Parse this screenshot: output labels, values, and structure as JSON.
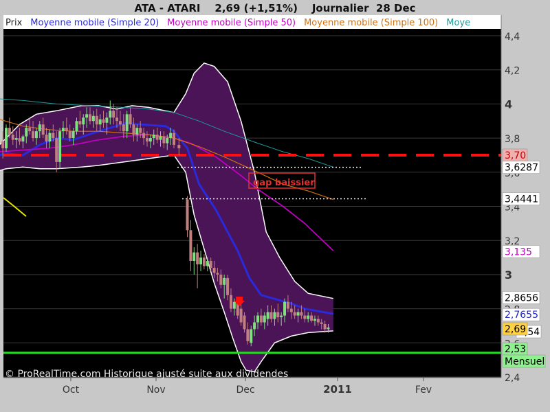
{
  "header": {
    "title": "ATA - ATARI",
    "price": "2,69 (+1,51%)",
    "period": "Journalier",
    "date": "28 Dec"
  },
  "legend": [
    {
      "label": "Prix",
      "color": "#222222"
    },
    {
      "label": "Moyenne mobile (Simple 20)",
      "color": "#2a2adc"
    },
    {
      "label": "Moyenne mobile (Simple 50)",
      "color": "#c000c0"
    },
    {
      "label": "Moyenne mobile (Simple 100)",
      "color": "#d07010"
    },
    {
      "label": "Moye",
      "color": "#209a9a"
    }
  ],
  "watermark": "© ProRealTime.com Historique ajusté suite aux dividendes",
  "chart_data": {
    "type": "candlestick",
    "ylim": [
      2.4,
      4.5
    ],
    "y_ticks": [
      "2,4",
      "2,6",
      "2,8",
      "3",
      "3,2",
      "3,4",
      "3,6",
      "3,8",
      "4",
      "4,2",
      "4,4"
    ],
    "x_labels": [
      {
        "label": "Oct",
        "date": "2010-10-01"
      },
      {
        "label": "Nov",
        "date": "2010-11-01"
      },
      {
        "label": "Dec",
        "date": "2010-12-01"
      },
      {
        "label": "2011",
        "date": "2011-01-01"
      },
      {
        "label": "Fev",
        "date": "2011-02-01"
      }
    ],
    "annotation": "gap baissier",
    "resistance_line": 3.7,
    "support_line": 2.53,
    "gap_lines": [
      3.6287,
      3.4441
    ],
    "price_tags": [
      {
        "text": "3,70",
        "value": 3.7,
        "bg": "#f0b0b0",
        "fg": "#c00000"
      },
      {
        "text": "3,6287",
        "value": 3.6287,
        "bg": "#ffffff",
        "fg": "#000000"
      },
      {
        "text": "3,4441",
        "value": 3.4441,
        "bg": "#ffffff",
        "fg": "#000000"
      },
      {
        "text": "3,135",
        "value": 3.135,
        "bg": "#ffffff",
        "fg": "#c000c0"
      },
      {
        "text": "2,8656",
        "value": 2.8656,
        "bg": "#ffffff",
        "fg": "#000000"
      },
      {
        "text": "2,7655",
        "value": 2.7655,
        "bg": "#ffffff",
        "fg": "#2020c0"
      },
      {
        "text": "2,54",
        "value": 2.7,
        "bg": "#ffffff",
        "fg": "#000000"
      },
      {
        "text": "2,69",
        "value": 2.69,
        "bg": "#ffd040",
        "fg": "#000000"
      },
      {
        "text": "2,53",
        "value": 2.53,
        "bg": "#90f090",
        "fg": "#000000"
      },
      {
        "text": "Mensuel",
        "value": 2.46,
        "bg": "#90f090",
        "fg": "#000000"
      }
    ],
    "series": [
      {
        "name": "Moyenne mobile (Simple 20)",
        "color": "#2a2adc",
        "points": [
          [
            -4,
            3.7
          ],
          [
            0,
            3.71
          ],
          [
            10,
            3.7
          ],
          [
            20,
            3.76
          ],
          [
            30,
            3.8
          ],
          [
            40,
            3.79
          ],
          [
            55,
            3.84
          ],
          [
            62,
            3.86
          ],
          [
            72,
            3.89
          ],
          [
            80,
            3.88
          ],
          [
            95,
            3.87
          ],
          [
            100,
            3.84
          ],
          [
            108,
            3.74
          ],
          [
            115,
            3.53
          ],
          [
            125,
            3.38
          ],
          [
            138,
            3.14
          ],
          [
            145,
            2.98
          ],
          [
            152,
            2.88
          ],
          [
            170,
            2.83
          ],
          [
            178,
            2.8
          ],
          [
            195,
            2.77
          ]
        ]
      },
      {
        "name": "Moyenne mobile (Simple 50)",
        "color": "#c000c0",
        "points": [
          [
            -4,
            3.72
          ],
          [
            10,
            3.73
          ],
          [
            25,
            3.74
          ],
          [
            40,
            3.76
          ],
          [
            55,
            3.79
          ],
          [
            70,
            3.81
          ],
          [
            85,
            3.82
          ],
          [
            100,
            3.8
          ],
          [
            110,
            3.77
          ],
          [
            125,
            3.69
          ],
          [
            140,
            3.58
          ],
          [
            150,
            3.5
          ],
          [
            165,
            3.4
          ],
          [
            178,
            3.3
          ],
          [
            195,
            3.14
          ]
        ]
      },
      {
        "name": "Moyenne mobile (Simple 100)",
        "color": "#d07010",
        "points": [
          [
            -4,
            3.91
          ],
          [
            10,
            3.87
          ],
          [
            25,
            3.85
          ],
          [
            40,
            3.84
          ],
          [
            55,
            3.84
          ],
          [
            70,
            3.83
          ],
          [
            85,
            3.82
          ],
          [
            100,
            3.8
          ],
          [
            115,
            3.75
          ],
          [
            130,
            3.69
          ],
          [
            150,
            3.6
          ],
          [
            165,
            3.53
          ],
          [
            180,
            3.49
          ],
          [
            195,
            3.44
          ]
        ]
      },
      {
        "name": "Moye",
        "color": "#209a9a",
        "points": [
          [
            -4,
            4.03
          ],
          [
            10,
            4.02
          ],
          [
            30,
            4.0
          ],
          [
            50,
            3.99
          ],
          [
            70,
            3.98
          ],
          [
            85,
            3.97
          ],
          [
            100,
            3.95
          ],
          [
            115,
            3.9
          ],
          [
            130,
            3.84
          ],
          [
            150,
            3.77
          ],
          [
            165,
            3.72
          ],
          [
            180,
            3.68
          ],
          [
            195,
            3.63
          ]
        ]
      }
    ],
    "bollinger": {
      "upper": [
        [
          -4,
          3.76
        ],
        [
          0,
          3.8
        ],
        [
          8,
          3.88
        ],
        [
          18,
          3.94
        ],
        [
          30,
          3.96
        ],
        [
          45,
          3.99
        ],
        [
          55,
          3.99
        ],
        [
          66,
          3.97
        ],
        [
          75,
          3.99
        ],
        [
          85,
          3.98
        ],
        [
          100,
          3.95
        ],
        [
          107,
          4.06
        ],
        [
          112,
          4.18
        ],
        [
          118,
          4.24
        ],
        [
          124,
          4.22
        ],
        [
          132,
          4.13
        ],
        [
          140,
          3.9
        ],
        [
          148,
          3.6
        ],
        [
          155,
          3.25
        ],
        [
          163,
          3.1
        ],
        [
          172,
          2.96
        ],
        [
          180,
          2.89
        ],
        [
          195,
          2.86
        ]
      ],
      "lower": [
        [
          -4,
          3.61
        ],
        [
          0,
          3.62
        ],
        [
          10,
          3.63
        ],
        [
          20,
          3.62
        ],
        [
          30,
          3.62
        ],
        [
          45,
          3.63
        ],
        [
          55,
          3.64
        ],
        [
          70,
          3.66
        ],
        [
          85,
          3.68
        ],
        [
          100,
          3.7
        ],
        [
          107,
          3.6
        ],
        [
          112,
          3.35
        ],
        [
          118,
          3.15
        ],
        [
          124,
          2.95
        ],
        [
          130,
          2.78
        ],
        [
          135,
          2.63
        ],
        [
          140,
          2.49
        ],
        [
          143,
          2.44
        ],
        [
          148,
          2.43
        ],
        [
          152,
          2.49
        ],
        [
          160,
          2.6
        ],
        [
          170,
          2.64
        ],
        [
          180,
          2.66
        ],
        [
          195,
          2.67
        ]
      ]
    },
    "candles": [
      {
        "t": -2,
        "o": 3.78,
        "h": 3.84,
        "l": 3.68,
        "c": 3.74
      },
      {
        "t": 0,
        "o": 3.74,
        "h": 3.88,
        "l": 3.72,
        "c": 3.86
      },
      {
        "t": 2,
        "o": 3.86,
        "h": 3.92,
        "l": 3.8,
        "c": 3.82
      },
      {
        "t": 4,
        "o": 3.82,
        "h": 3.87,
        "l": 3.76,
        "c": 3.79
      },
      {
        "t": 6,
        "o": 3.79,
        "h": 3.84,
        "l": 3.74,
        "c": 3.8
      },
      {
        "t": 8,
        "o": 3.8,
        "h": 3.86,
        "l": 3.76,
        "c": 3.78
      },
      {
        "t": 10,
        "o": 3.78,
        "h": 3.82,
        "l": 3.74,
        "c": 3.81
      },
      {
        "t": 12,
        "o": 3.81,
        "h": 3.88,
        "l": 3.77,
        "c": 3.86
      },
      {
        "t": 14,
        "o": 3.86,
        "h": 3.92,
        "l": 3.82,
        "c": 3.84
      },
      {
        "t": 16,
        "o": 3.84,
        "h": 3.9,
        "l": 3.78,
        "c": 3.8
      },
      {
        "t": 18,
        "o": 3.8,
        "h": 3.86,
        "l": 3.76,
        "c": 3.84
      },
      {
        "t": 20,
        "o": 3.84,
        "h": 3.9,
        "l": 3.8,
        "c": 3.88
      },
      {
        "t": 22,
        "o": 3.88,
        "h": 3.92,
        "l": 3.8,
        "c": 3.82
      },
      {
        "t": 24,
        "o": 3.82,
        "h": 3.86,
        "l": 3.74,
        "c": 3.78
      },
      {
        "t": 26,
        "o": 3.78,
        "h": 3.85,
        "l": 3.74,
        "c": 3.83
      },
      {
        "t": 28,
        "o": 3.83,
        "h": 3.88,
        "l": 3.78,
        "c": 3.8
      },
      {
        "t": 30,
        "o": 3.8,
        "h": 3.84,
        "l": 3.6,
        "c": 3.66
      },
      {
        "t": 32,
        "o": 3.66,
        "h": 3.86,
        "l": 3.62,
        "c": 3.84
      },
      {
        "t": 34,
        "o": 3.84,
        "h": 3.9,
        "l": 3.8,
        "c": 3.86
      },
      {
        "t": 36,
        "o": 3.86,
        "h": 3.92,
        "l": 3.82,
        "c": 3.84
      },
      {
        "t": 38,
        "o": 3.84,
        "h": 3.88,
        "l": 3.78,
        "c": 3.8
      },
      {
        "t": 40,
        "o": 3.8,
        "h": 3.86,
        "l": 3.76,
        "c": 3.84
      },
      {
        "t": 42,
        "o": 3.84,
        "h": 3.92,
        "l": 3.82,
        "c": 3.9
      },
      {
        "t": 44,
        "o": 3.9,
        "h": 3.96,
        "l": 3.86,
        "c": 3.88
      },
      {
        "t": 46,
        "o": 3.88,
        "h": 3.94,
        "l": 3.82,
        "c": 3.92
      },
      {
        "t": 48,
        "o": 3.92,
        "h": 3.98,
        "l": 3.86,
        "c": 3.94
      },
      {
        "t": 50,
        "o": 3.94,
        "h": 3.98,
        "l": 3.88,
        "c": 3.9
      },
      {
        "t": 52,
        "o": 3.9,
        "h": 3.96,
        "l": 3.86,
        "c": 3.93
      },
      {
        "t": 54,
        "o": 3.93,
        "h": 3.97,
        "l": 3.84,
        "c": 3.88
      },
      {
        "t": 56,
        "o": 3.88,
        "h": 3.94,
        "l": 3.84,
        "c": 3.91
      },
      {
        "t": 58,
        "o": 3.91,
        "h": 3.96,
        "l": 3.86,
        "c": 3.89
      },
      {
        "t": 60,
        "o": 3.89,
        "h": 3.95,
        "l": 3.82,
        "c": 3.92
      },
      {
        "t": 62,
        "o": 3.92,
        "h": 4.02,
        "l": 3.88,
        "c": 3.96
      },
      {
        "t": 64,
        "o": 3.96,
        "h": 4.0,
        "l": 3.88,
        "c": 3.92
      },
      {
        "t": 66,
        "o": 3.92,
        "h": 3.98,
        "l": 3.86,
        "c": 3.9
      },
      {
        "t": 68,
        "o": 3.9,
        "h": 3.96,
        "l": 3.84,
        "c": 3.88
      },
      {
        "t": 70,
        "o": 3.88,
        "h": 3.94,
        "l": 3.8,
        "c": 3.84
      },
      {
        "t": 72,
        "o": 3.84,
        "h": 3.96,
        "l": 3.8,
        "c": 3.94
      },
      {
        "t": 74,
        "o": 3.94,
        "h": 3.98,
        "l": 3.86,
        "c": 3.88
      },
      {
        "t": 76,
        "o": 3.88,
        "h": 3.92,
        "l": 3.78,
        "c": 3.82
      },
      {
        "t": 78,
        "o": 3.82,
        "h": 3.88,
        "l": 3.78,
        "c": 3.86
      },
      {
        "t": 80,
        "o": 3.86,
        "h": 3.9,
        "l": 3.8,
        "c": 3.83
      },
      {
        "t": 82,
        "o": 3.83,
        "h": 3.86,
        "l": 3.76,
        "c": 3.8
      },
      {
        "t": 84,
        "o": 3.8,
        "h": 3.84,
        "l": 3.75,
        "c": 3.78
      },
      {
        "t": 86,
        "o": 3.78,
        "h": 3.82,
        "l": 3.74,
        "c": 3.8
      },
      {
        "t": 88,
        "o": 3.8,
        "h": 3.85,
        "l": 3.76,
        "c": 3.82
      },
      {
        "t": 90,
        "o": 3.82,
        "h": 3.86,
        "l": 3.77,
        "c": 3.79
      },
      {
        "t": 92,
        "o": 3.79,
        "h": 3.84,
        "l": 3.75,
        "c": 3.81
      },
      {
        "t": 94,
        "o": 3.81,
        "h": 3.84,
        "l": 3.74,
        "c": 3.77
      },
      {
        "t": 96,
        "o": 3.77,
        "h": 3.82,
        "l": 3.73,
        "c": 3.8
      },
      {
        "t": 98,
        "o": 3.8,
        "h": 3.86,
        "l": 3.76,
        "c": 3.83
      },
      {
        "t": 100,
        "o": 3.83,
        "h": 3.85,
        "l": 3.74,
        "c": 3.76
      },
      {
        "t": 103,
        "o": 3.76,
        "h": 3.8,
        "l": 3.7,
        "c": 3.74
      },
      {
        "t": 108,
        "o": 3.44,
        "h": 3.46,
        "l": 3.22,
        "c": 3.26
      },
      {
        "t": 110,
        "o": 3.26,
        "h": 3.32,
        "l": 3.02,
        "c": 3.08
      },
      {
        "t": 112,
        "o": 3.08,
        "h": 3.16,
        "l": 3.0,
        "c": 3.13
      },
      {
        "t": 114,
        "o": 3.13,
        "h": 3.18,
        "l": 2.92,
        "c": 3.06
      },
      {
        "t": 116,
        "o": 3.06,
        "h": 3.14,
        "l": 3.02,
        "c": 3.1
      },
      {
        "t": 118,
        "o": 3.1,
        "h": 3.12,
        "l": 3.03,
        "c": 3.05
      },
      {
        "t": 120,
        "o": 3.05,
        "h": 3.1,
        "l": 3.02,
        "c": 3.08
      },
      {
        "t": 122,
        "o": 3.08,
        "h": 3.1,
        "l": 3.02,
        "c": 3.04
      },
      {
        "t": 124,
        "o": 3.04,
        "h": 3.08,
        "l": 2.98,
        "c": 3.01
      },
      {
        "t": 126,
        "o": 3.01,
        "h": 3.04,
        "l": 2.96,
        "c": 3.0
      },
      {
        "t": 128,
        "o": 3.0,
        "h": 3.03,
        "l": 2.92,
        "c": 2.94
      },
      {
        "t": 130,
        "o": 2.94,
        "h": 3.0,
        "l": 2.86,
        "c": 2.98
      },
      {
        "t": 132,
        "o": 2.98,
        "h": 3.0,
        "l": 2.85,
        "c": 2.88
      },
      {
        "t": 134,
        "o": 2.88,
        "h": 2.92,
        "l": 2.78,
        "c": 2.8
      },
      {
        "t": 136,
        "o": 2.8,
        "h": 2.86,
        "l": 2.76,
        "c": 2.84
      },
      {
        "t": 138,
        "o": 2.84,
        "h": 2.86,
        "l": 2.74,
        "c": 2.76
      },
      {
        "t": 140,
        "o": 2.8,
        "h": 2.84,
        "l": 2.7,
        "c": 2.72
      },
      {
        "t": 142,
        "o": 2.76,
        "h": 2.78,
        "l": 2.66,
        "c": 2.68
      },
      {
        "t": 144,
        "o": 2.68,
        "h": 2.72,
        "l": 2.59,
        "c": 2.61
      },
      {
        "t": 146,
        "o": 2.6,
        "h": 2.7,
        "l": 2.58,
        "c": 2.68
      },
      {
        "t": 148,
        "o": 2.68,
        "h": 2.76,
        "l": 2.64,
        "c": 2.72
      },
      {
        "t": 150,
        "o": 2.72,
        "h": 2.78,
        "l": 2.68,
        "c": 2.76
      },
      {
        "t": 152,
        "o": 2.76,
        "h": 2.8,
        "l": 2.7,
        "c": 2.72
      },
      {
        "t": 154,
        "o": 2.72,
        "h": 2.78,
        "l": 2.68,
        "c": 2.76
      },
      {
        "t": 156,
        "o": 2.74,
        "h": 2.82,
        "l": 2.7,
        "c": 2.78
      },
      {
        "t": 158,
        "o": 2.78,
        "h": 2.82,
        "l": 2.72,
        "c": 2.74
      },
      {
        "t": 160,
        "o": 2.74,
        "h": 2.8,
        "l": 2.7,
        "c": 2.78
      },
      {
        "t": 162,
        "o": 2.78,
        "h": 2.83,
        "l": 2.72,
        "c": 2.75
      },
      {
        "t": 164,
        "o": 2.75,
        "h": 2.78,
        "l": 2.7,
        "c": 2.76
      },
      {
        "t": 166,
        "o": 2.76,
        "h": 2.86,
        "l": 2.72,
        "c": 2.84
      },
      {
        "t": 168,
        "o": 2.84,
        "h": 2.88,
        "l": 2.78,
        "c": 2.8
      },
      {
        "t": 170,
        "o": 2.8,
        "h": 2.84,
        "l": 2.74,
        "c": 2.78
      },
      {
        "t": 172,
        "o": 2.78,
        "h": 2.82,
        "l": 2.74,
        "c": 2.76
      },
      {
        "t": 174,
        "o": 2.76,
        "h": 2.8,
        "l": 2.72,
        "c": 2.78
      },
      {
        "t": 176,
        "o": 2.78,
        "h": 2.82,
        "l": 2.74,
        "c": 2.76
      },
      {
        "t": 178,
        "o": 2.76,
        "h": 2.8,
        "l": 2.72,
        "c": 2.74
      },
      {
        "t": 180,
        "o": 2.74,
        "h": 2.78,
        "l": 2.72,
        "c": 2.76
      },
      {
        "t": 182,
        "o": 2.76,
        "h": 2.78,
        "l": 2.72,
        "c": 2.73
      },
      {
        "t": 184,
        "o": 2.73,
        "h": 2.76,
        "l": 2.7,
        "c": 2.74
      },
      {
        "t": 186,
        "o": 2.74,
        "h": 2.76,
        "l": 2.7,
        "c": 2.72
      },
      {
        "t": 188,
        "o": 2.72,
        "h": 2.74,
        "l": 2.68,
        "c": 2.71
      },
      {
        "t": 190,
        "o": 2.71,
        "h": 2.73,
        "l": 2.66,
        "c": 2.68
      },
      {
        "t": 192,
        "o": 2.68,
        "h": 2.71,
        "l": 2.66,
        "c": 2.69
      }
    ],
    "arrow_t": 139
  }
}
